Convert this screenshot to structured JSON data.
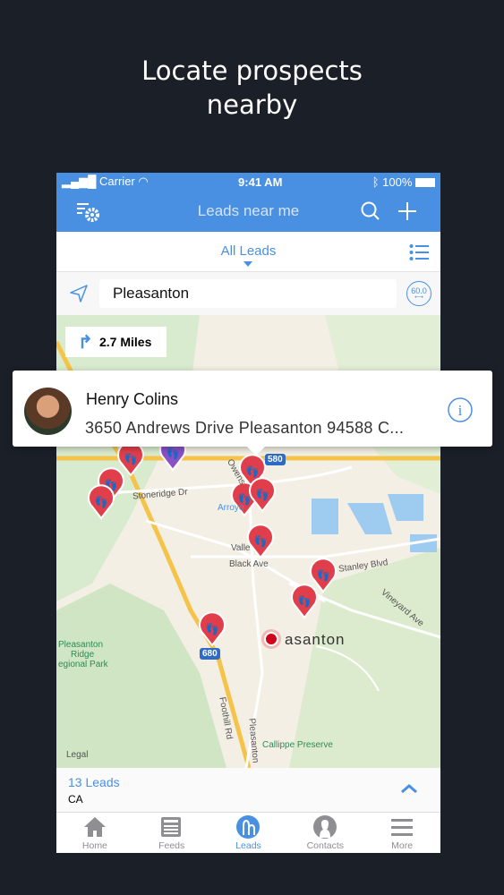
{
  "headline": {
    "line1": "Locate prospects",
    "line2": "nearby"
  },
  "status_bar": {
    "carrier": "Carrier",
    "time": "9:41 AM",
    "battery": "100%"
  },
  "nav": {
    "title": "Leads near me",
    "icons": [
      "filter-settings-icon",
      "search-icon",
      "plus-icon"
    ]
  },
  "filter": {
    "label": "All Leads",
    "list_icon": "list-icon"
  },
  "search": {
    "value": "Pleasanton",
    "radius": "60.0"
  },
  "map": {
    "distance": "2.7 Miles",
    "labels": {
      "stoneridge": "Stoneridge Dr",
      "owens": "Owens",
      "arroyo": "Arroyo",
      "valley": "Valle",
      "black": "Black Ave",
      "stanley": "Stanley Blvd",
      "vineyard": "Vineyard Ave",
      "city": "asanton",
      "park": "Pleasanton Ridge Regional Park",
      "park1": "Pleasanton",
      "park2": "Ridge",
      "park3": "egional Park",
      "foothill": "Foothill Rd",
      "callippe": "Callippe Preserve",
      "legal": "Legal",
      "i680": "680",
      "i580": "580",
      "pleasanton_rd": "Pleasanton"
    },
    "pin_color": "#e03e4a",
    "purple_pin_color": "#8b4fc7"
  },
  "lead_card": {
    "name": "Henry Colins",
    "address": "3650 Andrews Drive Pleasanton 94588 C..."
  },
  "summary": {
    "count": "13 Leads",
    "region": "CA"
  },
  "tabs": [
    {
      "label": "Home",
      "icon": "home-icon"
    },
    {
      "label": "Feeds",
      "icon": "feeds-icon"
    },
    {
      "label": "Leads",
      "icon": "leads-icon",
      "active": true
    },
    {
      "label": "Contacts",
      "icon": "contacts-icon"
    },
    {
      "label": "More",
      "icon": "menu-icon"
    }
  ],
  "colors": {
    "accent": "#4a90e2",
    "background": "#1b1f28"
  }
}
